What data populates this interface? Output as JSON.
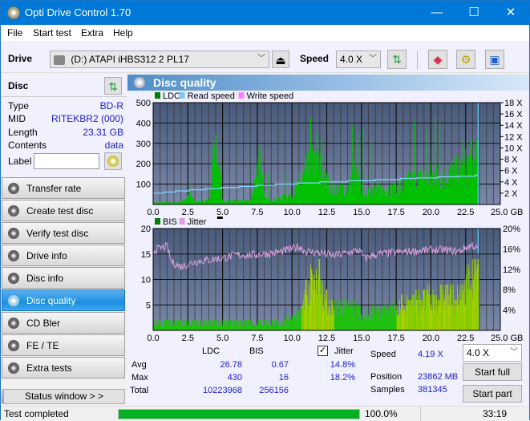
{
  "window": {
    "title": "Opti Drive Control 1.70",
    "controls": {
      "minimize": "—",
      "maximize": "☐",
      "close": "✕"
    }
  },
  "menu": [
    "File",
    "Start test",
    "Extra",
    "Help"
  ],
  "toolbar": {
    "drive_label": "Drive",
    "drive_value": "(D:)   ATAPI iHBS312   2 PL17",
    "speed_label": "Speed",
    "speed_value": "4.0 X",
    "icons": [
      "eject-icon",
      "refresh-icon",
      "eraser-icon",
      "settings-icon",
      "save-icon"
    ]
  },
  "disc": {
    "header": "Disc",
    "rows": [
      {
        "label": "Type",
        "value": "BD-R"
      },
      {
        "label": "MID",
        "value": "RITEKBR2 (000)"
      },
      {
        "label": "Length",
        "value": "23.31 GB"
      },
      {
        "label": "Contents",
        "value": "data"
      }
    ],
    "label_field": {
      "label": "Label",
      "value": ""
    }
  },
  "nav": [
    {
      "label": "Transfer rate",
      "active": false
    },
    {
      "label": "Create test disc",
      "active": false
    },
    {
      "label": "Verify test disc",
      "active": false
    },
    {
      "label": "Drive info",
      "active": false
    },
    {
      "label": "Disc info",
      "active": false
    },
    {
      "label": "Disc quality",
      "active": true
    },
    {
      "label": "CD Bler",
      "active": false
    },
    {
      "label": "FE / TE",
      "active": false
    },
    {
      "label": "Extra tests",
      "active": false
    }
  ],
  "status_window_button": "Status window > >",
  "panel_title": "Disc quality",
  "chart_data": [
    {
      "type": "bar",
      "title": "LDC",
      "legend": [
        "LDC",
        "Read speed",
        "Write speed"
      ],
      "legend_colors": {
        "LDC": "#008000",
        "Read speed": "#80c8f0",
        "Write speed": "#ff80ff"
      },
      "xlabel": "GB",
      "x_ticks": [
        "0.0",
        "2.5",
        "5.0",
        "7.5",
        "10.0",
        "12.5",
        "15.0",
        "17.5",
        "20.0",
        "22.5",
        "25.0 GB"
      ],
      "xlim": [
        0,
        25
      ],
      "ylim": [
        0,
        500
      ],
      "y_ticks": [
        "500",
        "400",
        "300",
        "200",
        "100"
      ],
      "y2_ticks": [
        "18 X",
        "16 X",
        "14 X",
        "12 X",
        "10 X",
        "8 X",
        "6 X",
        "4 X",
        "2 X"
      ],
      "y2lim": [
        0,
        18
      ],
      "ldc_envelope": [
        [
          0,
          10
        ],
        [
          1,
          12
        ],
        [
          2,
          14
        ],
        [
          2.6,
          60
        ],
        [
          3,
          15
        ],
        [
          4,
          20
        ],
        [
          4.3,
          300
        ],
        [
          4.6,
          300
        ],
        [
          5,
          18
        ],
        [
          6,
          20
        ],
        [
          7,
          22
        ],
        [
          7.7,
          290
        ],
        [
          8,
          25
        ],
        [
          9,
          35
        ],
        [
          10,
          60
        ],
        [
          10.5,
          120
        ],
        [
          11,
          200
        ],
        [
          11.5,
          250
        ],
        [
          12,
          220
        ],
        [
          12.3,
          150
        ],
        [
          13,
          90
        ],
        [
          14,
          100
        ],
        [
          14.5,
          180
        ],
        [
          15,
          90
        ],
        [
          15.1,
          20
        ],
        [
          15.5,
          100
        ],
        [
          16,
          90
        ],
        [
          17,
          90
        ],
        [
          18,
          110
        ],
        [
          18.5,
          140
        ],
        [
          19,
          150
        ],
        [
          20,
          170
        ],
        [
          21,
          180
        ],
        [
          21.5,
          190
        ],
        [
          22,
          200
        ],
        [
          22.5,
          230
        ],
        [
          23,
          260
        ],
        [
          23.4,
          265
        ]
      ],
      "ldc_spikes": [
        [
          2.6,
          110
        ],
        [
          4.3,
          305
        ],
        [
          4.6,
          300
        ],
        [
          7.6,
          295
        ],
        [
          8.3,
          150
        ],
        [
          9.5,
          155
        ],
        [
          10.5,
          170
        ],
        [
          11.3,
          425
        ],
        [
          11.8,
          360
        ],
        [
          12.1,
          320
        ],
        [
          14.3,
          390
        ],
        [
          14.7,
          350
        ],
        [
          15.1,
          380
        ],
        [
          15.7,
          310
        ],
        [
          18.8,
          410
        ],
        [
          19.7,
          370
        ],
        [
          20.3,
          430
        ],
        [
          20.6,
          400
        ],
        [
          22.3,
          320
        ],
        [
          22.9,
          325
        ]
      ],
      "read_speed_x": [
        [
          0,
          2
        ],
        [
          0.8,
          2.2
        ],
        [
          1.6,
          2.4
        ],
        [
          2.6,
          2.6
        ],
        [
          3.8,
          2.8
        ],
        [
          4.9,
          3.0
        ],
        [
          6.2,
          3.2
        ],
        [
          7.5,
          3.4
        ],
        [
          8.8,
          3.6
        ],
        [
          10.4,
          3.8
        ],
        [
          12,
          4.0
        ],
        [
          14,
          4.2
        ],
        [
          16,
          4.4
        ],
        [
          17.8,
          4.6
        ],
        [
          19,
          4.7
        ],
        [
          20.5,
          4.9
        ],
        [
          22,
          5.0
        ],
        [
          23.2,
          5.2
        ],
        [
          23.4,
          5.4
        ]
      ],
      "end_marker_gb": 23.4
    },
    {
      "type": "bar",
      "title": "BIS",
      "legend": [
        "BIS",
        "Jitter"
      ],
      "legend_colors": {
        "BIS": "#008000",
        "Jitter": "#e0a0e0"
      },
      "xlabel": "GB",
      "x_ticks": [
        "0.0",
        "2.5",
        "5.0",
        "7.5",
        "10.0",
        "12.5",
        "15.0",
        "17.5",
        "20.0",
        "22.5",
        "25.0 GB"
      ],
      "xlim": [
        0,
        25
      ],
      "ylim": [
        0,
        20
      ],
      "y_ticks": [
        "20",
        "15",
        "10",
        "5"
      ],
      "y2_ticks": [
        "20%",
        "16%",
        "12%",
        "8%",
        "4%"
      ],
      "y2lim": [
        0,
        20
      ],
      "bis_envelope": [
        [
          0,
          2
        ],
        [
          2,
          2
        ],
        [
          4,
          2
        ],
        [
          5,
          2
        ],
        [
          7,
          2
        ],
        [
          8,
          2
        ],
        [
          9,
          2
        ],
        [
          10,
          3
        ],
        [
          10.5,
          4
        ],
        [
          11,
          11
        ],
        [
          11.5,
          13
        ],
        [
          12,
          14
        ],
        [
          12.3,
          8
        ],
        [
          13,
          6
        ],
        [
          14,
          6
        ],
        [
          15,
          5
        ],
        [
          15.1,
          3
        ],
        [
          16,
          5
        ],
        [
          17,
          5
        ],
        [
          18,
          7
        ],
        [
          19,
          8
        ],
        [
          20,
          8
        ],
        [
          21,
          9
        ],
        [
          22,
          8
        ],
        [
          22.5,
          12
        ],
        [
          23,
          13
        ],
        [
          23.4,
          14
        ]
      ],
      "jitter_pct": [
        [
          0,
          15.7
        ],
        [
          1,
          16.5
        ],
        [
          1.3,
          13.5
        ],
        [
          2,
          12.5
        ],
        [
          3,
          13.5
        ],
        [
          4,
          13.8
        ],
        [
          5,
          14.2
        ],
        [
          6,
          14.8
        ],
        [
          7,
          14.8
        ],
        [
          8,
          15
        ],
        [
          9,
          15.3
        ],
        [
          10,
          16
        ],
        [
          10.5,
          16.5
        ],
        [
          11,
          15.5
        ],
        [
          12,
          15.2
        ],
        [
          13,
          14.7
        ],
        [
          14,
          15.2
        ],
        [
          14.8,
          15.8
        ],
        [
          15.2,
          14.2
        ],
        [
          16,
          14.9
        ],
        [
          17,
          15.2
        ],
        [
          18,
          15.4
        ],
        [
          19,
          15.6
        ],
        [
          20,
          15.8
        ],
        [
          21,
          15.8
        ],
        [
          22,
          15.5
        ],
        [
          22.5,
          16.2
        ],
        [
          23,
          16.8
        ],
        [
          23.4,
          15.8
        ]
      ],
      "end_marker_gb": 23.4
    }
  ],
  "stats": {
    "columns": [
      "LDC",
      "BIS"
    ],
    "rows": [
      {
        "label": "Avg",
        "ldc": "26.78",
        "bis": "0.67",
        "jitter": "14.8%"
      },
      {
        "label": "Max",
        "ldc": "430",
        "bis": "16",
        "jitter": "18.2%"
      },
      {
        "label": "Total",
        "ldc": "10223968",
        "bis": "256156",
        "jitter": ""
      }
    ],
    "jitter_label": "Jitter",
    "jitter_checked": true,
    "speed_label": "Speed",
    "speed_value": "4.19 X",
    "position_label": "Position",
    "position_value": "23862 MB",
    "samples_label": "Samples",
    "samples_value": "381345",
    "speed_select": "4.0 X",
    "start_full": "Start full",
    "start_part": "Start part"
  },
  "statusbar": {
    "text": "Test completed",
    "progress": 100.0,
    "progress_text": "100.0%",
    "time": "33:19"
  }
}
